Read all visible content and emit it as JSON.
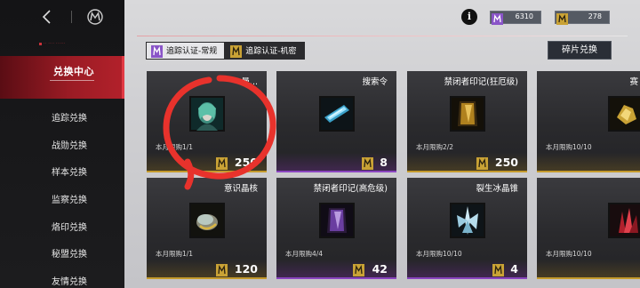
{
  "nav": {
    "tiny_label": "·· ···· ······",
    "active_section": "兑换中心",
    "items": [
      {
        "label": "追踪兑换"
      },
      {
        "label": "战勋兑换"
      },
      {
        "label": "样本兑换"
      },
      {
        "label": "监察兑换"
      },
      {
        "label": "烙印兑换"
      },
      {
        "label": "秘盟兑换"
      },
      {
        "label": "友情兑换"
      }
    ]
  },
  "header": {
    "info_label": "i",
    "currencies": [
      {
        "icon": "purple-trace-cert-icon",
        "value": "6310",
        "color": "#8a55c8"
      },
      {
        "icon": "gold-trace-cert-icon",
        "value": "278",
        "color": "#c9a235"
      }
    ]
  },
  "tabs": [
    {
      "label": "追踪认证-常规",
      "icon": "purple-trace-cert-icon",
      "selected": false
    },
    {
      "label": "追踪认证-机密",
      "icon": "gold-trace-cert-icon",
      "selected": true
    }
  ],
  "fragment_button": "碎片兑换",
  "cards": [
    {
      "name": "曼...",
      "limit": "本月限购1/1",
      "price": "250",
      "price_icon": "gold-trace-cert-icon",
      "rarity_color": "#c49a2c",
      "item_icon": "character-portrait-icon"
    },
    {
      "name": "搜索令",
      "limit": "",
      "price": "8",
      "price_icon": "gold-trace-cert-icon",
      "rarity_color": "#8a45c0",
      "item_icon": "search-ticket-icon"
    },
    {
      "name": "禁闭者印记(狂厄级)",
      "limit": "本月限购2/2",
      "price": "250",
      "price_icon": "gold-trace-cert-icon",
      "rarity_color": "#c49a2c",
      "item_icon": "gold-seal-card-icon"
    },
    {
      "name": "赛",
      "limit": "本月限购10/10",
      "price": "",
      "price_icon": "gold-trace-cert-icon",
      "rarity_color": "#c49a2c",
      "item_icon": "gold-ore-icon"
    },
    {
      "name": "意识晶核",
      "limit": "本月限购1/1",
      "price": "120",
      "price_icon": "gold-trace-cert-icon",
      "rarity_color": "#c49a2c",
      "item_icon": "crystal-core-icon"
    },
    {
      "name": "禁闭者印记(高危级)",
      "limit": "本月限购4/4",
      "price": "42",
      "price_icon": "gold-trace-cert-icon",
      "rarity_color": "#8a45c0",
      "item_icon": "purple-seal-card-icon"
    },
    {
      "name": "裂生冰晶锥",
      "limit": "本月限购10/10",
      "price": "4",
      "price_icon": "gold-trace-cert-icon",
      "rarity_color": "#8a45c0",
      "item_icon": "ice-crystal-icon"
    },
    {
      "name": "",
      "limit": "本月限购10/10",
      "price": "",
      "price_icon": "gold-trace-cert-icon",
      "rarity_color": "#c49a2c",
      "item_icon": "red-crystal-icon"
    }
  ],
  "overlay": {
    "shape": "red-circle-annotation",
    "color": "#e8322c"
  }
}
